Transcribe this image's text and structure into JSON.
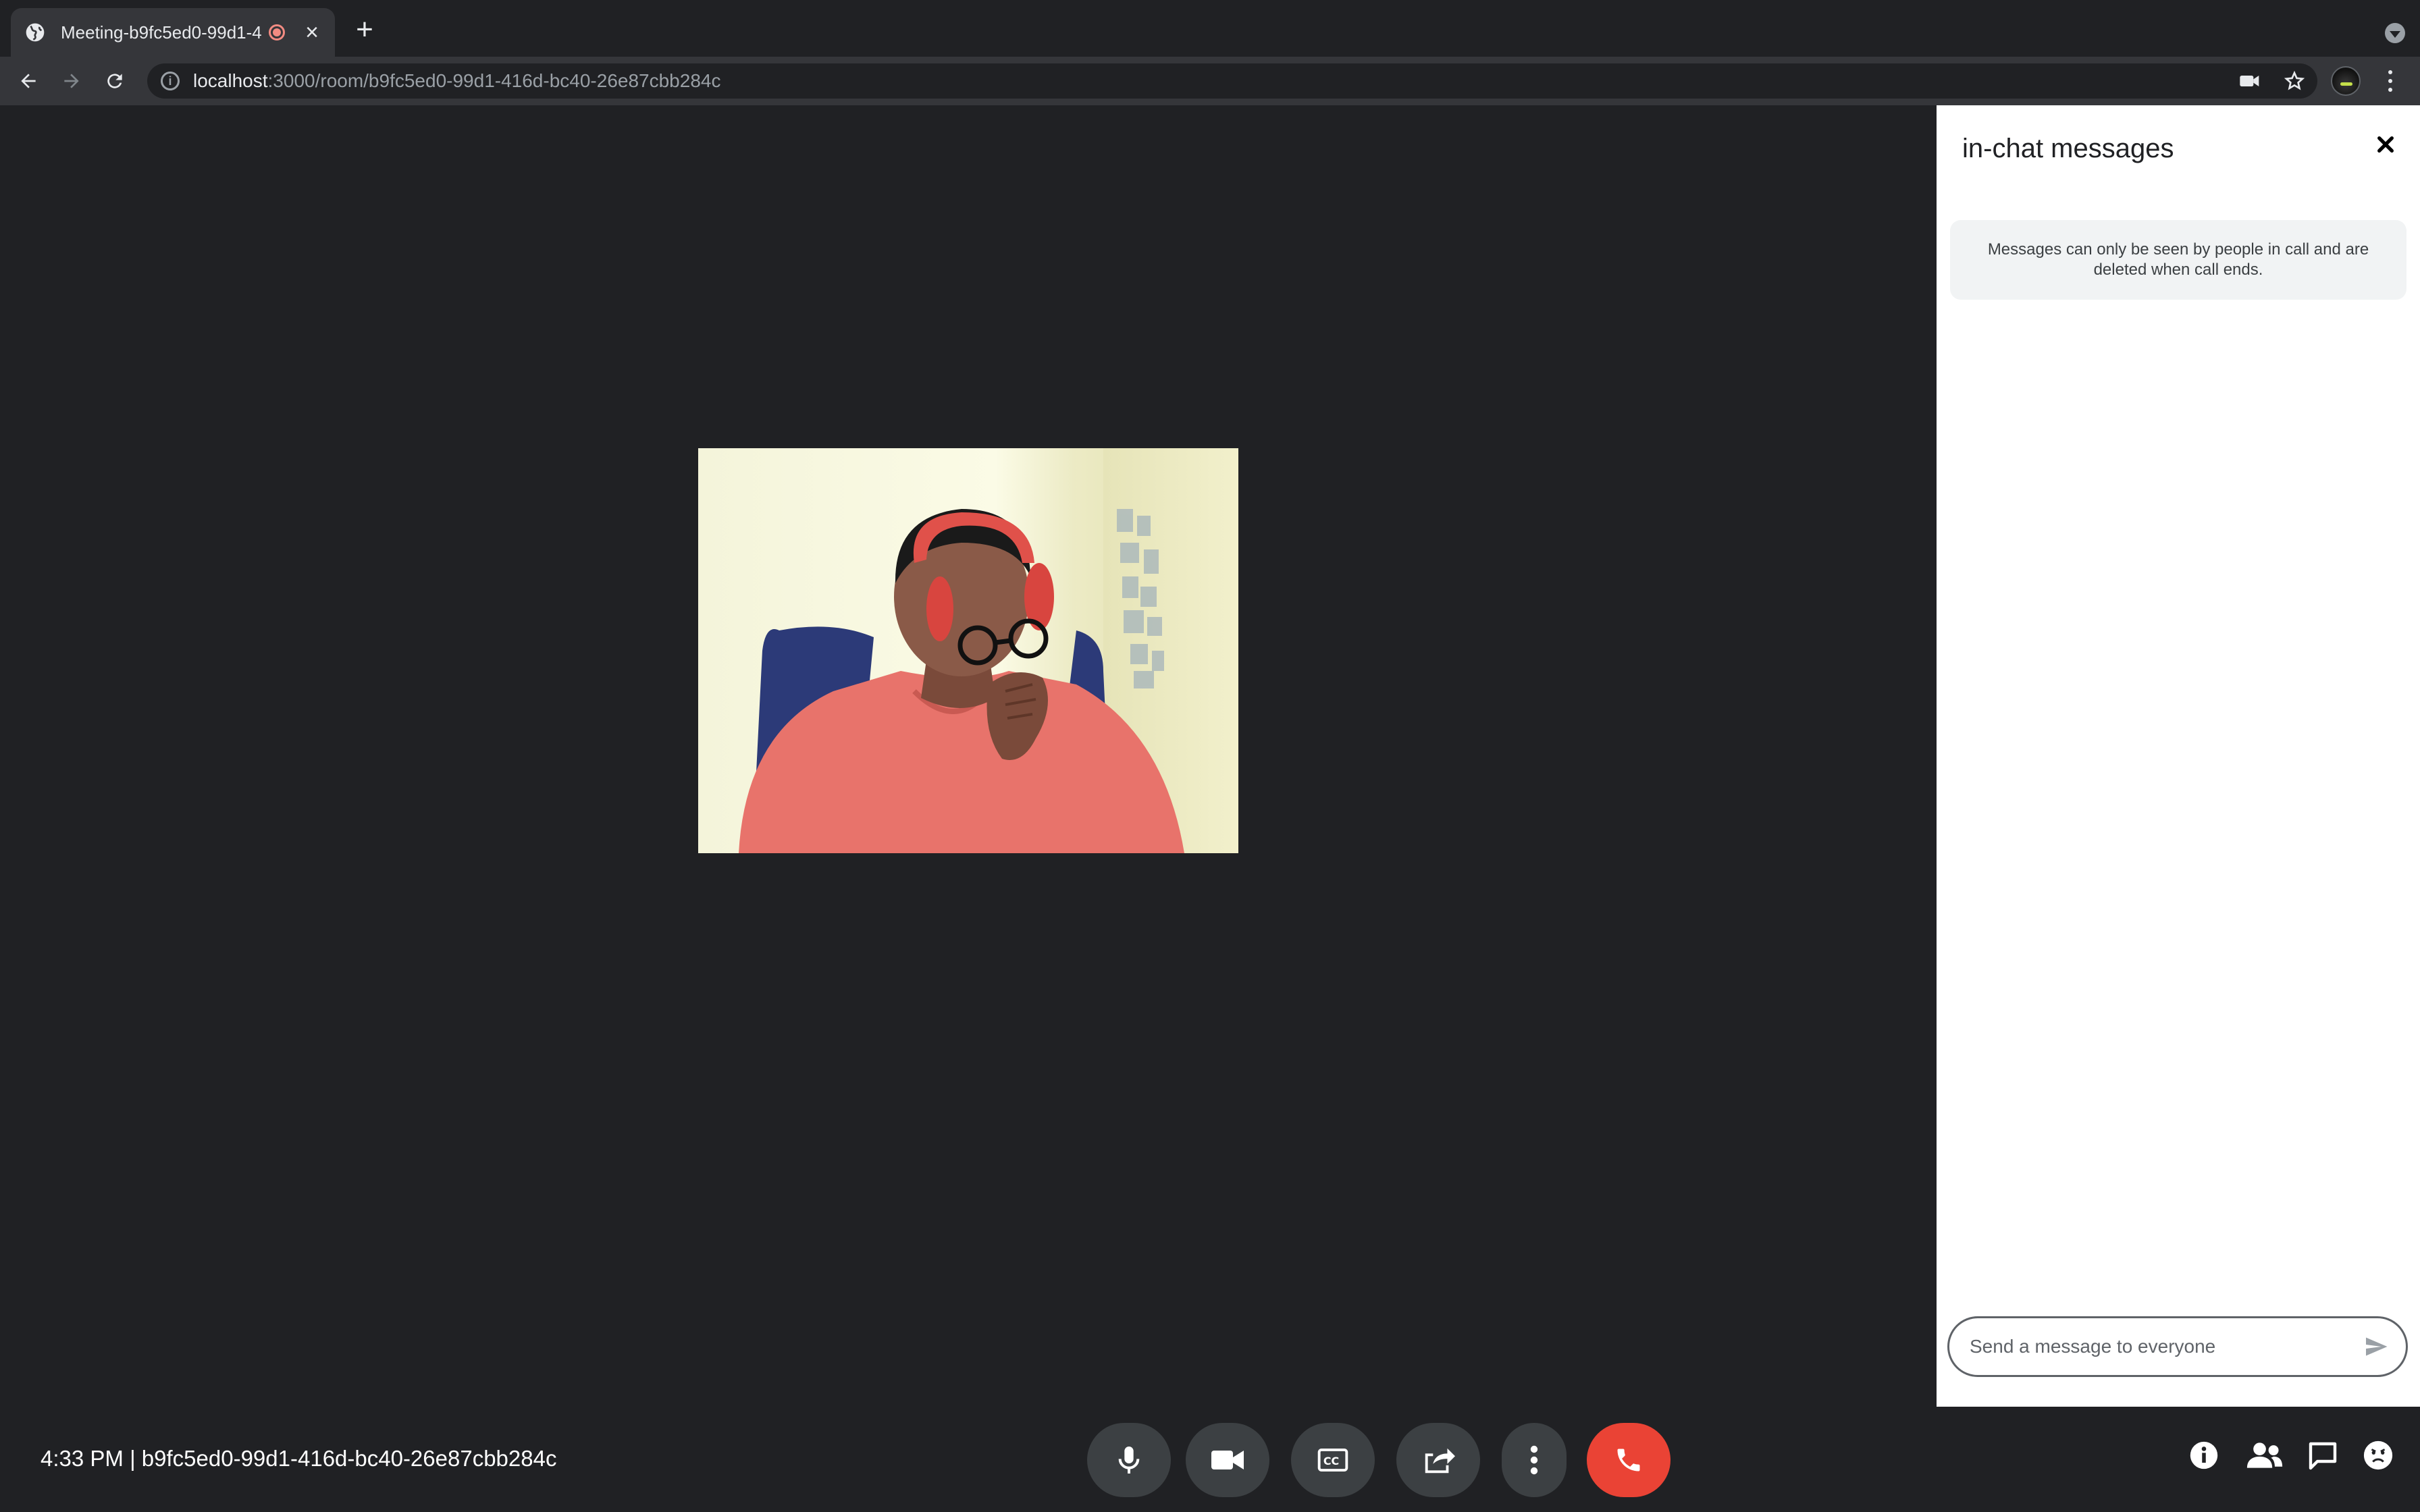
{
  "browser": {
    "tab_title": "Meeting-b9fc5ed0-99d1-4",
    "url_host": "localhost",
    "url_path": ":3000/room/b9fc5ed0-99d1-416d-bc40-26e87cbb284c"
  },
  "chat": {
    "title": "in-chat messages",
    "close_label": "✕",
    "notice": "Messages can only be seen by people in call and are deleted when call ends.",
    "input_placeholder": "Send a message to everyone",
    "input_value": ""
  },
  "controls": {
    "meeting_info": "4:33 PM | b9fc5ed0-99d1-416d-bc40-26e87cbb284c",
    "buttons": [
      "mic-icon",
      "camera-icon",
      "closed-captions-icon",
      "present-icon",
      "more-options-icon",
      "end-call-icon"
    ],
    "right_buttons": [
      "info-icon",
      "people-icon",
      "chat-icon",
      "reaction-icon"
    ]
  },
  "colors": {
    "background": "#202124",
    "end_call": "#ea4335",
    "control_button": "#3c4043",
    "chat_panel": "#ffffff"
  }
}
